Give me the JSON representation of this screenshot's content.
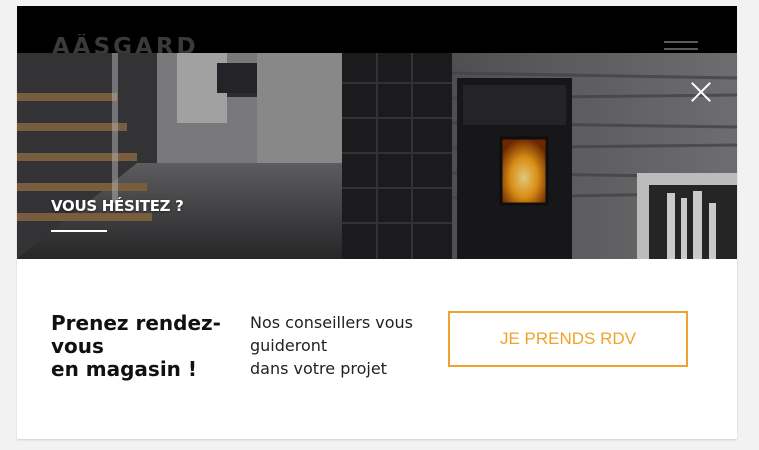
{
  "site": {
    "logo": "AÄSGARD"
  },
  "popup": {
    "hero_title": "VOUS HÉSITEZ ?",
    "heading_line1": "Prenez rendez-vous",
    "heading_line2": "en magasin !",
    "subtext_line1": "Nos conseillers vous guideront",
    "subtext_line2": "dans votre projet",
    "button_label": "JE PRENDS RDV"
  },
  "colors": {
    "accent": "#f0a32a",
    "hero_text": "#ffffff",
    "topbar": "#000000"
  },
  "icons": {
    "close": "close-icon",
    "menu": "hamburger-menu-icon"
  }
}
